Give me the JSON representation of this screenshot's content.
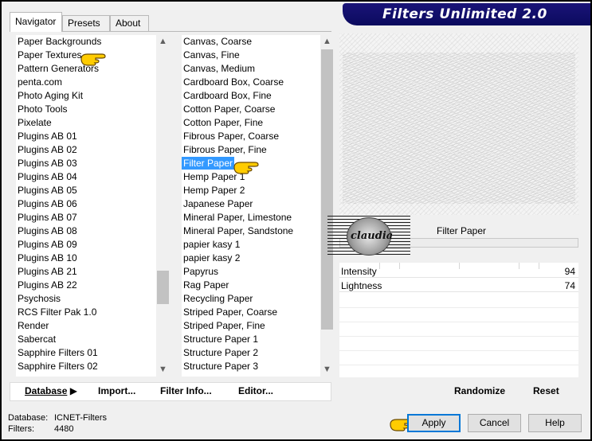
{
  "banner_title": "Filters Unlimited 2.0",
  "tabs": [
    {
      "label": "Navigator",
      "active": true
    },
    {
      "label": "Presets",
      "active": false
    },
    {
      "label": "About",
      "active": false
    }
  ],
  "categories": [
    "Paper Backgrounds",
    "Paper Textures",
    "Pattern Generators",
    "penta.com",
    "Photo Aging Kit",
    "Photo Tools",
    "Pixelate",
    "Plugins AB 01",
    "Plugins AB 02",
    "Plugins AB 03",
    "Plugins AB 04",
    "Plugins AB 05",
    "Plugins AB 06",
    "Plugins AB 07",
    "Plugins AB 08",
    "Plugins AB 09",
    "Plugins AB 10",
    "Plugins AB 21",
    "Plugins AB 22",
    "Psychosis",
    "RCS Filter Pak 1.0",
    "Render",
    "Sabercat",
    "Sapphire Filters 01",
    "Sapphire Filters 02"
  ],
  "filters": [
    "Canvas, Coarse",
    "Canvas, Fine",
    "Canvas, Medium",
    "Cardboard Box, Coarse",
    "Cardboard Box, Fine",
    "Cotton Paper, Coarse",
    "Cotton Paper, Fine",
    "Fibrous Paper, Coarse",
    "Fibrous Paper, Fine",
    "Filter Paper",
    "Hemp Paper 1",
    "Hemp Paper 2",
    "Japanese Paper",
    "Mineral Paper, Limestone",
    "Mineral Paper, Sandstone",
    "papier kasy 1",
    "papier kasy 2",
    "Papyrus",
    "Rag Paper",
    "Recycling Paper",
    "Striped Paper, Coarse",
    "Striped Paper, Fine",
    "Structure Paper 1",
    "Structure Paper 2",
    "Structure Paper 3"
  ],
  "selected_category": "Paper Textures",
  "selected_filter": "Filter Paper",
  "preview": {
    "filter_name": "Filter Paper",
    "watermark": "claudia"
  },
  "params": [
    {
      "label": "Intensity",
      "value": "94"
    },
    {
      "label": "Lightness",
      "value": "74"
    }
  ],
  "toolbar": {
    "database": "Database",
    "import": "Import...",
    "filter_info": "Filter Info...",
    "editor": "Editor..."
  },
  "right_toolbar": {
    "randomize": "Randomize",
    "reset": "Reset"
  },
  "db_info": {
    "database_label": "Database:",
    "database_value": "ICNET-Filters",
    "filters_label": "Filters:",
    "filters_value": "4480"
  },
  "buttons": {
    "apply": "Apply",
    "cancel": "Cancel",
    "help": "Help"
  },
  "colors": {
    "banner": "#0b0a5e",
    "selection": "#3399ff",
    "pointer_hand": "#ffcc00"
  }
}
